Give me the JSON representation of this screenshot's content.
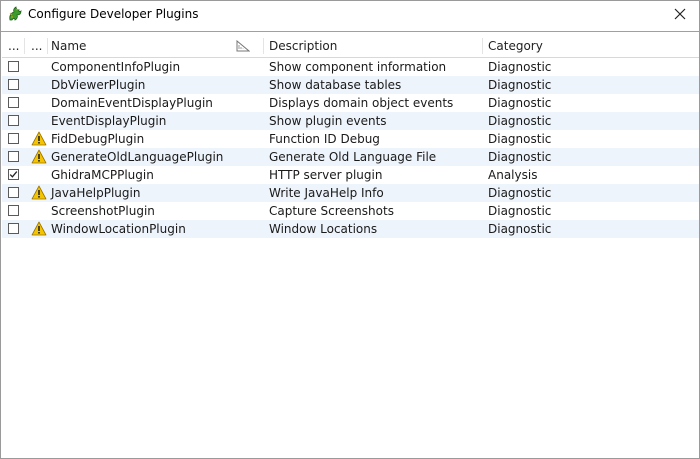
{
  "window": {
    "title": "Configure Developer Plugins"
  },
  "table": {
    "columns": {
      "enabled": "...",
      "status": "...",
      "name": "Name",
      "description": "Description",
      "category": "Category"
    },
    "rows": [
      {
        "name": "ComponentInfoPlugin",
        "description": "Show component information",
        "category": "Diagnostic",
        "enabled": false,
        "warning": false
      },
      {
        "name": "DbViewerPlugin",
        "description": "Show database tables",
        "category": "Diagnostic",
        "enabled": false,
        "warning": false
      },
      {
        "name": "DomainEventDisplayPlugin",
        "description": "Displays domain object events",
        "category": "Diagnostic",
        "enabled": false,
        "warning": false
      },
      {
        "name": "EventDisplayPlugin",
        "description": "Show plugin events",
        "category": "Diagnostic",
        "enabled": false,
        "warning": false
      },
      {
        "name": "FidDebugPlugin",
        "description": "Function ID Debug",
        "category": "Diagnostic",
        "enabled": false,
        "warning": true
      },
      {
        "name": "GenerateOldLanguagePlugin",
        "description": "Generate Old Language File",
        "category": "Diagnostic",
        "enabled": false,
        "warning": true
      },
      {
        "name": "GhidraMCPPlugin",
        "description": "HTTP server plugin",
        "category": "Analysis",
        "enabled": true,
        "warning": false
      },
      {
        "name": "JavaHelpPlugin",
        "description": "Write JavaHelp Info",
        "category": "Diagnostic",
        "enabled": false,
        "warning": true
      },
      {
        "name": "ScreenshotPlugin",
        "description": "Capture Screenshots",
        "category": "Diagnostic",
        "enabled": false,
        "warning": false
      },
      {
        "name": "WindowLocationPlugin",
        "description": "Window Locations",
        "category": "Diagnostic",
        "enabled": false,
        "warning": true
      }
    ]
  },
  "icons": {
    "app": "dragon-icon",
    "close": "close-icon",
    "sort": "sort-icon",
    "warning": "warning-icon",
    "checkbox": "checkbox-icon"
  },
  "colors": {
    "alt_row": "#eef4fb",
    "warning_fill": "#f5c400",
    "app_icon": "#3c9a2e"
  }
}
